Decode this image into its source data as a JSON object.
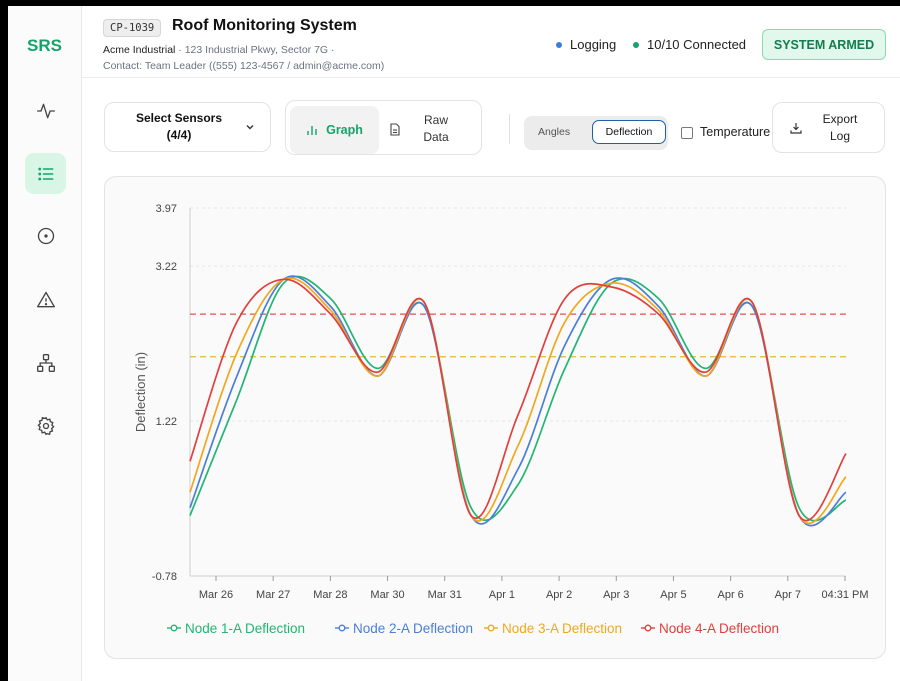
{
  "sidebar": {
    "logo": "SRS",
    "items": [
      {
        "icon": "activity-icon",
        "active": false
      },
      {
        "icon": "list-icon",
        "active": true
      },
      {
        "icon": "target-icon",
        "active": false
      },
      {
        "icon": "alert-triangle-icon",
        "active": false
      },
      {
        "icon": "network-icon",
        "active": false
      },
      {
        "icon": "gear-icon",
        "active": false
      }
    ]
  },
  "header": {
    "id": "CP-1039",
    "title": "Roof Monitoring System",
    "company": "Acme Industrial",
    "address": "123 Industrial Pkwy, Sector 7G",
    "contact": "Contact: Team Leader ((555) 123-4567 / admin@acme.com)",
    "logging": "Logging",
    "connected": "10/10 Connected",
    "armed": "SYSTEM ARMED"
  },
  "toolbar": {
    "select_sensors": "Select Sensors",
    "select_count": "(4/4)",
    "graph": "Graph",
    "raw_line1": "Raw",
    "raw_line2": "Data",
    "angles": "Angles",
    "deflection": "Deflection",
    "temperature": "Temperature",
    "export_line1": "Export",
    "export_line2": "Log"
  },
  "colors": {
    "accent": "#16a36a",
    "node1": "#22b573",
    "node2": "#4a7fd8",
    "node3": "#f0a81f",
    "node4": "#e0403d",
    "threshold_red": "#e05151",
    "threshold_amber": "#e8b43a"
  },
  "chart_data": {
    "type": "line",
    "ylabel": "Deflection (in)",
    "ylim": [
      -0.78,
      3.97
    ],
    "yticks": [
      "3.97",
      "3.22",
      "1.22",
      "-0.78"
    ],
    "x": [
      "Mar 26",
      "Mar 27",
      "Mar 28",
      "Mar 30",
      "Mar 31",
      "Apr 1",
      "Apr 2",
      "Apr 3",
      "Apr 5",
      "Apr 6",
      "Apr 7",
      "04:31 PM"
    ],
    "thresholds": [
      {
        "value": 2.6,
        "color": "red",
        "style": "dashed"
      },
      {
        "value": 2.05,
        "color": "amber",
        "style": "dashed"
      }
    ],
    "legend_position": "bottom",
    "series": [
      {
        "name": "Node 1-A Deflection",
        "values": [
          0.0,
          1.5,
          3.0,
          2.8,
          1.9,
          2.7,
          0.1,
          0.4,
          1.9,
          3.0,
          2.8,
          1.9,
          2.7,
          0.1,
          0.2
        ]
      },
      {
        "name": "Node 2-A Deflection",
        "values": [
          0.1,
          1.8,
          3.05,
          2.7,
          1.8,
          2.7,
          0.0,
          0.6,
          2.2,
          3.05,
          2.7,
          1.8,
          2.7,
          0.0,
          0.3
        ]
      },
      {
        "name": "Node 3-A Deflection",
        "values": [
          0.3,
          2.1,
          3.05,
          2.65,
          1.8,
          2.75,
          0.0,
          0.9,
          2.5,
          3.0,
          2.65,
          1.8,
          2.75,
          0.0,
          0.5
        ]
      },
      {
        "name": "Node 4-A Deflection",
        "values": [
          0.7,
          2.5,
          3.05,
          2.6,
          1.85,
          2.75,
          0.0,
          1.3,
          2.8,
          2.95,
          2.6,
          1.85,
          2.75,
          0.0,
          0.8
        ]
      }
    ]
  }
}
